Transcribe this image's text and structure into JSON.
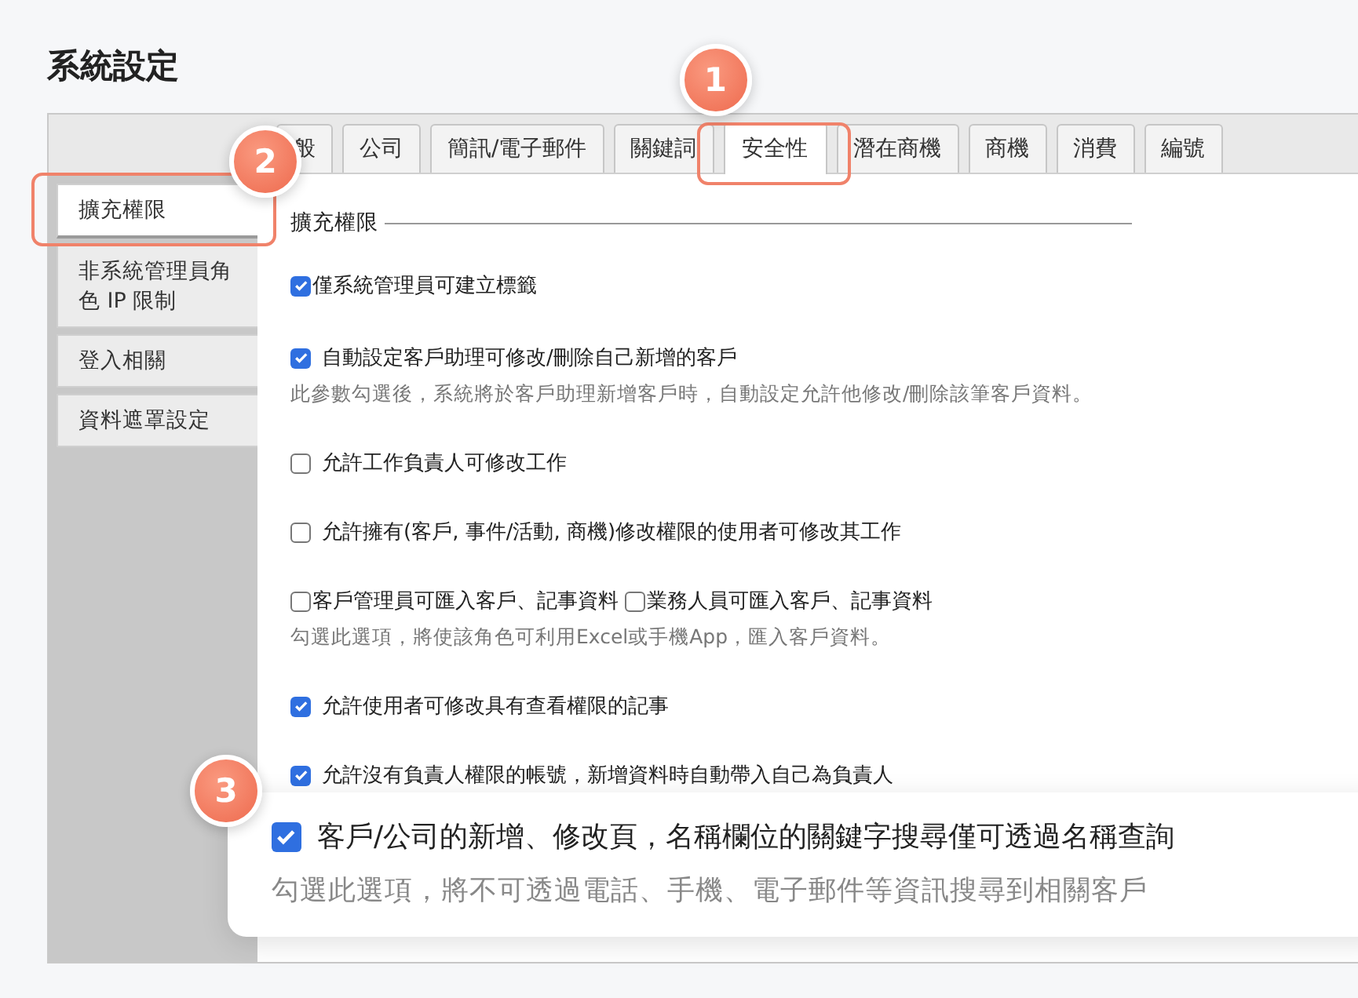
{
  "title": "系統設定",
  "tabs": [
    {
      "label": "般",
      "selected": false
    },
    {
      "label": "公司",
      "selected": false
    },
    {
      "label": "簡訊/電子郵件",
      "selected": false
    },
    {
      "label": "關鍵詞",
      "selected": false
    },
    {
      "label": "安全性",
      "selected": true,
      "badge": "1"
    },
    {
      "label": "潛在商機",
      "selected": false
    },
    {
      "label": "商機",
      "selected": false
    },
    {
      "label": "消費",
      "selected": false
    },
    {
      "label": "編號",
      "selected": false
    }
  ],
  "sidebar": {
    "items": [
      {
        "label": "擴充權限",
        "selected": true,
        "badge": "2"
      },
      {
        "label": "非系統管理員角色 IP 限制",
        "selected": false
      },
      {
        "label": "登入相關",
        "selected": false
      },
      {
        "label": "資料遮罩設定",
        "selected": false
      }
    ]
  },
  "section_title": "擴充權限",
  "options": [
    {
      "kind": "checkbox",
      "label": "僅系統管理員可建立標籤",
      "checked": true,
      "tight": true
    },
    {
      "kind": "checkbox",
      "label": "自動設定客戶助理可修改/刪除自己新增的客戶",
      "checked": true,
      "note": "此參數勾選後，系統將於客戶助理新增客戶時，自動設定允許他修改/刪除該筆客戶資料。"
    },
    {
      "kind": "checkbox",
      "label": "允許工作負責人可修改工作",
      "checked": false
    },
    {
      "kind": "checkbox",
      "label": "允許擁有(客戶, 事件/活動, 商機)修改權限的使用者可修改其工作",
      "checked": false
    },
    {
      "kind": "pair",
      "items": [
        {
          "label": "客戶管理員可匯入客戶、記事資料",
          "checked": false
        },
        {
          "label": "業務人員可匯入客戶、記事資料",
          "checked": false
        }
      ],
      "note": "勾選此選項，將使該角色可利用Excel或手機App，匯入客戶資料。"
    },
    {
      "kind": "checkbox",
      "label": "允許使用者可修改具有查看權限的記事",
      "checked": true
    },
    {
      "kind": "checkbox",
      "label": "允許沒有負責人權限的帳號，新增資料時自動帶入自己為負責人",
      "checked": true
    }
  ],
  "callout": {
    "badge": "3",
    "label": "客戶/公司的新增、修改頁，名稱欄位的關鍵字搜尋僅可透過名稱查詢",
    "checked": true,
    "note": "勾選此選項，將不可透過電話、手機、電子郵件等資訊搜尋到相關客戶"
  }
}
